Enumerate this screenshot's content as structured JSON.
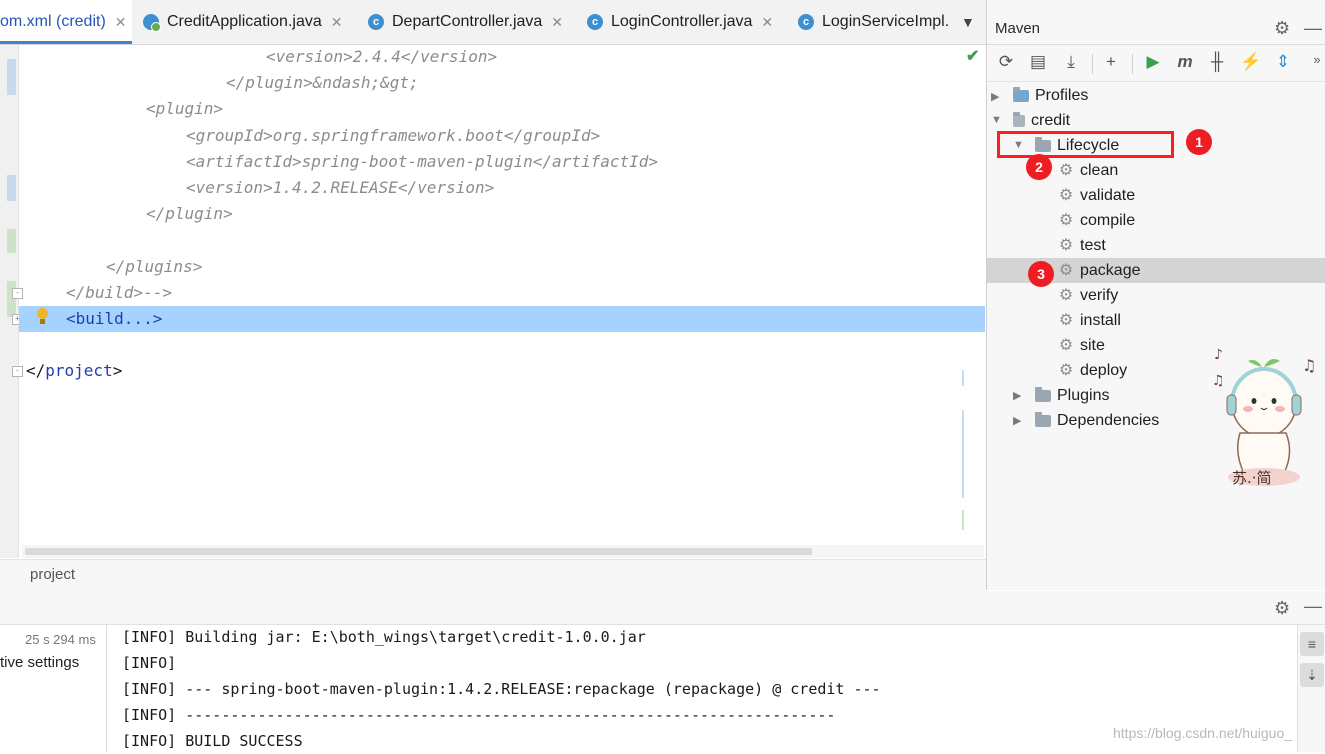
{
  "tabs": [
    {
      "label": "om.xml (credit)",
      "active": true,
      "icon": "none",
      "close": "✕"
    },
    {
      "label": "CreditApplication.java",
      "icon": "spring-app-icon",
      "close": "✕"
    },
    {
      "label": "DepartController.java",
      "icon": "class-c-icon",
      "close": "✕"
    },
    {
      "label": "LoginController.java",
      "icon": "class-c-icon",
      "close": "✕"
    },
    {
      "label": "LoginServiceImpl.",
      "icon": "class-c-icon",
      "close": ""
    }
  ],
  "tab_more_glyph": "▼",
  "class_icon_letter": "c",
  "editor": {
    "lines": [
      {
        "indent": "            ",
        "text": "<version>2.4.4</version>",
        "style": "comment"
      },
      {
        "indent": "        ",
        "text": "</plugin>&ndash;&gt;",
        "style": "comment"
      },
      {
        "indent": "    ",
        "text": "<plugin>",
        "style": "comment"
      },
      {
        "indent": "        ",
        "text": "<groupId>org.springframework.boot</groupId>",
        "style": "comment"
      },
      {
        "indent": "        ",
        "text": "<artifactId>spring-boot-maven-plugin</artifactId>",
        "style": "comment"
      },
      {
        "indent": "        ",
        "text": "<version>1.4.2.RELEASE</version>",
        "style": "comment"
      },
      {
        "indent": "    ",
        "text": "</plugin>",
        "style": "comment"
      },
      {
        "indent": "",
        "text": "",
        "style": "comment"
      },
      {
        "indent": "  ",
        "text": "</plugins>",
        "style": "comment"
      },
      {
        "indent": "",
        "text": "</build>-->",
        "style": "comment"
      },
      {
        "indent": "",
        "text": "<build...>",
        "style": "folded"
      },
      {
        "indent": "",
        "text": "",
        "style": "plain"
      },
      {
        "indent": "",
        "text": "</project>",
        "style": "tag"
      }
    ],
    "breadcrumb": "project"
  },
  "maven": {
    "title": "Maven",
    "tree": {
      "profiles": "Profiles",
      "project": "credit",
      "lifecycle": "Lifecycle",
      "phases": [
        "clean",
        "validate",
        "compile",
        "test",
        "package",
        "verify",
        "install",
        "site",
        "deploy"
      ],
      "plugins": "Plugins",
      "dependencies": "Dependencies"
    },
    "selected_phase": "package",
    "annotations": [
      "1",
      "2",
      "3"
    ],
    "sticker_text": "苏.·简"
  },
  "bottom": {
    "duration": "25 s 294 ms",
    "settings_label": "tive settings",
    "log": [
      "[INFO] Building jar: E:\\both_wings\\target\\credit-1.0.0.jar",
      "[INFO]",
      "[INFO] --- spring-boot-maven-plugin:1.4.2.RELEASE:repackage (repackage) @ credit ---",
      "[INFO] ------------------------------------------------------------------------",
      "[INFO] BUILD SUCCESS"
    ],
    "watermark": "https://blog.csdn.net/huiguo_"
  },
  "colors": {
    "accent": "#4083c9",
    "selection": "#a6d2ff",
    "annotation_red": "#ee1d23"
  }
}
